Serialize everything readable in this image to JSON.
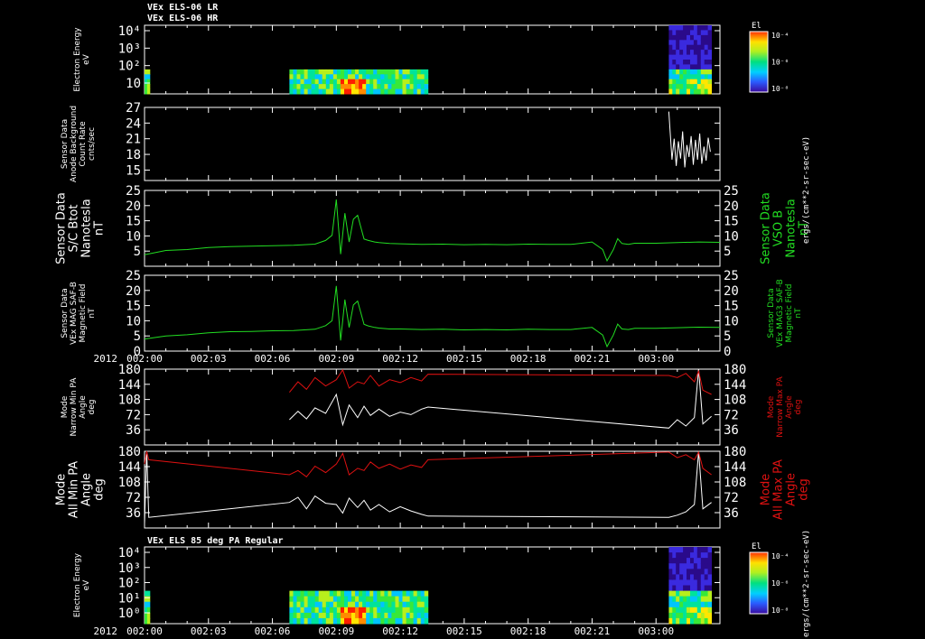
{
  "header": {
    "line1": "VEx ELS-06 LR",
    "line2": "VEx ELS-06 HR",
    "lower_title": "VEx ELS 85 deg PA Regular"
  },
  "colorbar": {
    "label": "El",
    "ticks": [
      "10⁻⁴",
      "10⁻⁶",
      "10⁻⁸"
    ]
  },
  "flux_unit": "ergs/(cm**2-sr-sec-eV)",
  "year": "2012",
  "time_ticks": [
    "002:00",
    "002:03",
    "002:06",
    "002:09",
    "002:12",
    "002:15",
    "002:18",
    "002:21",
    "003:00"
  ],
  "colors": {
    "white": "#ffffff",
    "green": "#22dd22",
    "red": "#dd1111",
    "background": "#000000"
  },
  "chart_data": [
    {
      "type": "heatmap",
      "title": "VEx ELS-06 LR / VEx ELS-06 HR",
      "ylabel": [
        "Electron Energy",
        "eV"
      ],
      "ylim": [
        1,
        10000
      ],
      "yscale": "log",
      "y_ticks": [
        "10⁴",
        "10³",
        "10²",
        "10"
      ],
      "xlim": [
        0,
        27
      ],
      "data_intervals": [
        [
          0,
          0.25
        ],
        [
          6.8,
          13.3
        ],
        [
          24.6,
          26.6
        ]
      ]
    },
    {
      "type": "line",
      "ylabel": [
        "Sensor Data",
        "Anode Background",
        "Count Rate",
        "cnts/sec"
      ],
      "ylim": [
        13,
        27
      ],
      "y_ticks": [
        "27",
        "24",
        "21",
        "18",
        "15"
      ],
      "series": [
        {
          "color": "#ffffff",
          "x": [
            24.6,
            24.75,
            24.85,
            24.95,
            25.05,
            25.15,
            25.25,
            25.35,
            25.45,
            25.55,
            25.65,
            25.75,
            25.85,
            25.95,
            26.05,
            26.15,
            26.25,
            26.35,
            26.45,
            26.55
          ],
          "y": [
            26.2,
            17,
            21,
            15.8,
            20.5,
            17.2,
            22.4,
            15.5,
            19.8,
            17.5,
            21.5,
            16,
            20.8,
            17,
            22,
            16.2,
            19.5,
            16.8,
            21.2,
            18.5
          ]
        }
      ]
    },
    {
      "type": "line",
      "ylabel": [
        "Sensor Data",
        "S/C Btot",
        "Nanotesla",
        "nT"
      ],
      "ylabel_right": [
        "Sensor Data",
        "VSO B",
        "Nanotesla",
        "nT"
      ],
      "ylim": [
        0,
        25
      ],
      "y_ticks": [
        "25",
        "20",
        "15",
        "10",
        "5"
      ],
      "series": [
        {
          "color": "#22dd22",
          "x": [
            0,
            1,
            2,
            3,
            4,
            5,
            6,
            7,
            7.5,
            8,
            8.5,
            8.8,
            9,
            9.2,
            9.4,
            9.6,
            9.8,
            10,
            10.3,
            10.5,
            10.8,
            11,
            11.5,
            12,
            13,
            14,
            15,
            16,
            17,
            18,
            19,
            20,
            21,
            21.5,
            21.7,
            22,
            22.2,
            22.4,
            22.7,
            23,
            24,
            25,
            26,
            27
          ],
          "y": [
            3.8,
            5.2,
            5.5,
            6.2,
            6.5,
            6.6,
            6.8,
            6.9,
            7.1,
            7.3,
            8.5,
            10.2,
            22,
            4,
            17.5,
            8,
            15.5,
            16.8,
            9,
            8.5,
            8,
            7.8,
            7.5,
            7.4,
            7.2,
            7.3,
            7.1,
            7.2,
            7.1,
            7.3,
            7.2,
            7.2,
            8,
            5.5,
            1.8,
            5.5,
            9.1,
            7.5,
            7.2,
            7.6,
            7.6,
            7.8,
            8,
            7.9
          ]
        }
      ]
    },
    {
      "type": "line",
      "ylabel": [
        "Sensor Data",
        "VEx MAG SAF-B",
        "Magnetic Field",
        "nT"
      ],
      "ylabel_right": [
        "Sensor Data",
        "VEx MAG3 SAF-B",
        "Magnetic Field",
        "nT"
      ],
      "ylim": [
        0,
        25
      ],
      "y_ticks": [
        "25",
        "20",
        "15",
        "10",
        "5",
        "0"
      ],
      "series": [
        {
          "color": "#22dd22",
          "x": [
            0,
            1,
            2,
            3,
            4,
            5,
            6,
            7,
            7.5,
            8,
            8.5,
            8.8,
            9,
            9.2,
            9.4,
            9.6,
            9.8,
            10,
            10.3,
            10.5,
            10.8,
            11,
            11.5,
            12,
            13,
            14,
            15,
            16,
            17,
            18,
            19,
            20,
            21,
            21.5,
            21.7,
            22,
            22.2,
            22.4,
            22.7,
            23,
            24,
            25,
            26,
            27
          ],
          "y": [
            4,
            5,
            5.4,
            6,
            6.4,
            6.5,
            6.7,
            6.8,
            7,
            7.2,
            8.4,
            10,
            21.5,
            3.5,
            17,
            7.8,
            15.2,
            16.5,
            8.8,
            8.3,
            7.8,
            7.6,
            7.3,
            7.3,
            7.1,
            7.2,
            7,
            7.1,
            7,
            7.2,
            7.1,
            7.1,
            7.8,
            5.3,
            1.5,
            5.3,
            8.9,
            7.3,
            7.1,
            7.5,
            7.5,
            7.7,
            7.9,
            7.8
          ]
        }
      ]
    },
    {
      "type": "line",
      "ylabel": [
        "Mode",
        "Narrow Min PA",
        "Angle",
        "deg"
      ],
      "ylabel_right": [
        "Mode",
        "Narrow Max PA",
        "Angle",
        "deg"
      ],
      "ylim": [
        0,
        180
      ],
      "y_ticks": [
        "180",
        "144",
        "108",
        "72",
        "36"
      ],
      "series": [
        {
          "name": "Narrow Min PA",
          "color": "#ffffff",
          "x": [
            6.8,
            7.2,
            7.6,
            8,
            8.5,
            9,
            9.3,
            9.6,
            10,
            10.3,
            10.6,
            11,
            11.5,
            12,
            12.5,
            13,
            13.3,
            24.6,
            25,
            25.4,
            25.8,
            26,
            26.2,
            26.6
          ],
          "y": [
            60,
            80,
            62,
            88,
            75,
            120,
            48,
            95,
            65,
            92,
            70,
            85,
            68,
            78,
            72,
            85,
            90,
            40,
            60,
            45,
            65,
            180,
            50,
            68
          ]
        },
        {
          "name": "Narrow Max PA",
          "color": "#dd1111",
          "x": [
            6.8,
            7.2,
            7.6,
            8,
            8.5,
            9,
            9.3,
            9.6,
            10,
            10.3,
            10.6,
            11,
            11.5,
            12,
            12.5,
            13,
            13.3,
            24.6,
            25,
            25.4,
            25.8,
            26,
            26.2,
            26.6
          ],
          "y": [
            125,
            150,
            132,
            160,
            140,
            155,
            178,
            135,
            150,
            145,
            165,
            140,
            155,
            148,
            160,
            152,
            168,
            165,
            160,
            170,
            150,
            175,
            130,
            120
          ]
        }
      ]
    },
    {
      "type": "line",
      "ylabel": [
        "Mode",
        "All Min PA",
        "Angle",
        "deg"
      ],
      "ylabel_right": [
        "Mode",
        "All Max PA",
        "Angle",
        "deg"
      ],
      "ylim": [
        0,
        180
      ],
      "y_ticks": [
        "180",
        "144",
        "108",
        "72",
        "36"
      ],
      "series": [
        {
          "name": "All Min PA",
          "color": "#ffffff",
          "x": [
            0,
            0.1,
            0.2,
            6.8,
            7.2,
            7.6,
            8,
            8.5,
            9,
            9.3,
            9.6,
            10,
            10.3,
            10.6,
            11,
            11.5,
            12,
            12.5,
            13,
            13.3,
            24.6,
            25,
            25.4,
            25.8,
            26,
            26.2,
            26.6
          ],
          "y": [
            10,
            180,
            25,
            60,
            72,
            45,
            75,
            58,
            55,
            35,
            70,
            48,
            65,
            42,
            55,
            38,
            50,
            40,
            32,
            28,
            25,
            30,
            38,
            55,
            180,
            45,
            60
          ]
        },
        {
          "name": "All Max PA",
          "color": "#dd1111",
          "x": [
            0,
            0.1,
            0.2,
            6.8,
            7.2,
            7.6,
            8,
            8.5,
            9,
            9.3,
            9.6,
            10,
            10.3,
            10.6,
            11,
            11.5,
            12,
            12.5,
            13,
            13.3,
            24.6,
            25,
            25.4,
            25.8,
            26,
            26.2,
            26.6
          ],
          "y": [
            150,
            180,
            160,
            125,
            135,
            120,
            145,
            130,
            150,
            175,
            125,
            140,
            135,
            155,
            140,
            150,
            138,
            148,
            142,
            160,
            178,
            165,
            172,
            160,
            178,
            140,
            125
          ]
        }
      ]
    },
    {
      "type": "heatmap",
      "title": "VEx ELS 85 deg PA Regular",
      "ylabel": [
        "Electron Energy",
        "eV"
      ],
      "ylim": [
        1,
        10000
      ],
      "yscale": "log",
      "y_ticks": [
        "10⁴",
        "10³",
        "10²",
        "10¹",
        "10⁰"
      ],
      "xlim": [
        0,
        27
      ],
      "data_intervals": [
        [
          0,
          0.25
        ],
        [
          6.8,
          13.3
        ],
        [
          24.6,
          26.6
        ]
      ]
    }
  ]
}
